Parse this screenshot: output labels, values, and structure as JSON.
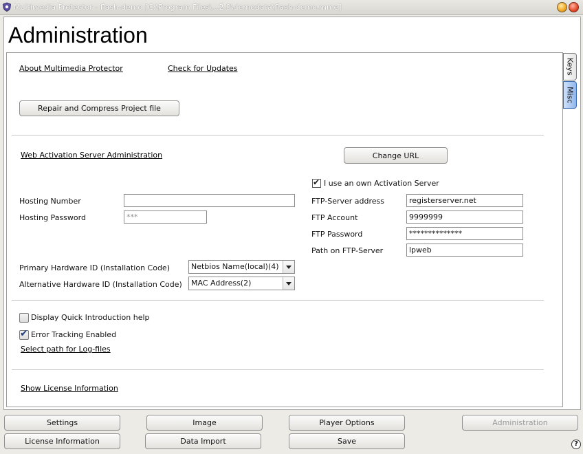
{
  "window": {
    "title": "Multimedia Protector - flash-demo [C:\\Program Files\\...2.0\\demodata\\flash-demo.mme]"
  },
  "page": {
    "title": "Administration"
  },
  "top_links": {
    "about": "About Multimedia Protector",
    "check_updates": "Check for Updates"
  },
  "repair_button": "Repair and Compress Project file",
  "web_activation": {
    "heading": "Web Activation Server Administration",
    "change_url_button": "Change URL",
    "own_server_label": "I use an own Activation Server",
    "own_server_checked": true,
    "hosting_number_label": "Hosting Number",
    "hosting_number_value": "",
    "hosting_password_label": "Hosting Password",
    "hosting_password_value": "***",
    "ftp_server_label": "FTP-Server address",
    "ftp_server_value": "registerserver.net",
    "ftp_account_label": "FTP Account",
    "ftp_account_value": "9999999",
    "ftp_password_label": "FTP Password",
    "ftp_password_value": "**************",
    "ftp_path_label": "Path on FTP-Server",
    "ftp_path_value": "lpweb"
  },
  "hardware": {
    "primary_label": "Primary Hardware ID (Installation Code)",
    "primary_value": "Netbios Name(local)(4)",
    "alternative_label": "Alternative Hardware ID (Installation Code)",
    "alternative_value": "MAC Address(2)"
  },
  "options": {
    "quick_intro_label": "Display Quick Introduction help",
    "quick_intro_checked": false,
    "error_tracking_label": "Error Tracking Enabled",
    "error_tracking_checked": true,
    "log_path_link": "Select path for Log-files"
  },
  "license_link": "Show License Information",
  "side_tabs": [
    {
      "label": "Keys",
      "active": false
    },
    {
      "label": "Misc",
      "active": true
    }
  ],
  "nav_buttons": {
    "settings": "Settings",
    "image": "Image",
    "player_options": "Player Options",
    "administration": "Administration",
    "license_information": "License Information",
    "data_import": "Data Import",
    "save": "Save"
  },
  "help_icon": "?",
  "colors": {
    "active_tab": "#8fb6ea",
    "panel_bg": "#ffffff",
    "window_bg": "#ecebe6"
  }
}
